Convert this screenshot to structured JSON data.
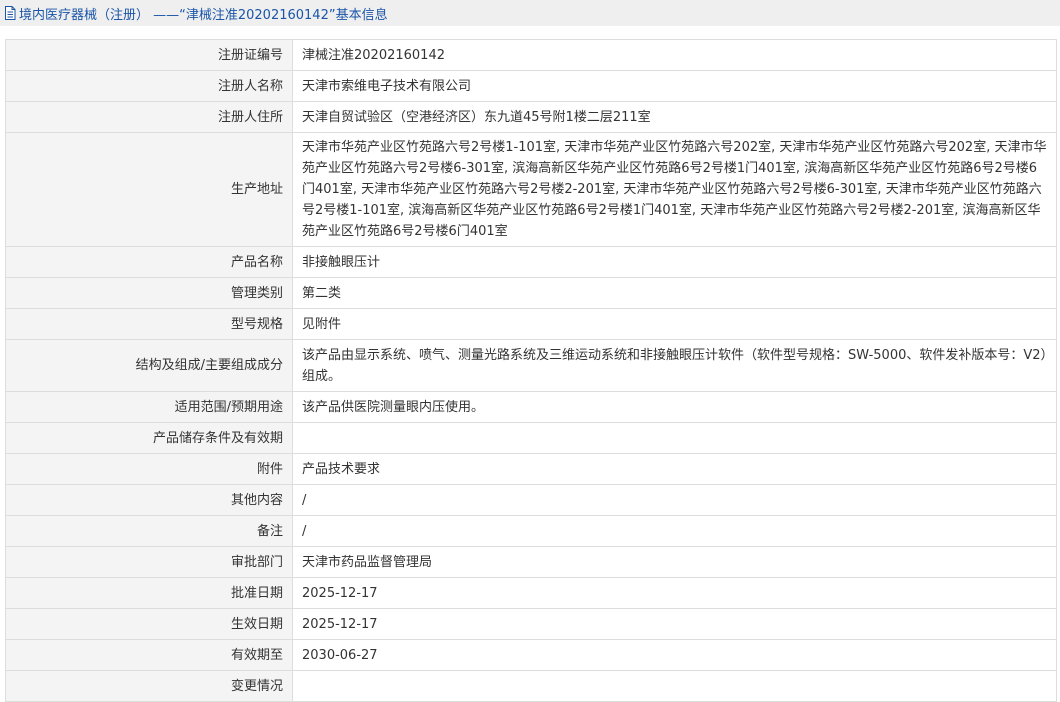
{
  "header": {
    "icon": "document-icon",
    "title": "境内医疗器械（注册） ——“津械注准20202160142”基本信息"
  },
  "rows": [
    {
      "label": "注册证编号",
      "value": "津械注准20202160142"
    },
    {
      "label": "注册人名称",
      "value": "天津市索维电子技术有限公司"
    },
    {
      "label": "注册人住所",
      "value": "天津自贸试验区（空港经济区）东九道45号附1楼二层211室"
    },
    {
      "label": "生产地址",
      "value": "天津市华苑产业区竹苑路六号2号楼1-101室, 天津市华苑产业区竹苑路六号202室, 天津市华苑产业区竹苑路六号202室, 天津市华苑产业区竹苑路六号2号楼6-301室, 滨海高新区华苑产业区竹苑路6号2号楼1门401室, 滨海高新区华苑产业区竹苑路6号2号楼6门401室, 天津市华苑产业区竹苑路六号2号楼2-201室, 天津市华苑产业区竹苑路六号2号楼6-301室, 天津市华苑产业区竹苑路六号2号楼1-101室, 滨海高新区华苑产业区竹苑路6号2号楼1门401室, 天津市华苑产业区竹苑路六号2号楼2-201室, 滨海高新区华苑产业区竹苑路6号2号楼6门401室"
    },
    {
      "label": "产品名称",
      "value": "非接触眼压计"
    },
    {
      "label": "管理类别",
      "value": "第二类"
    },
    {
      "label": "型号规格",
      "value": "见附件"
    },
    {
      "label": "结构及组成/主要组成成分",
      "value": "该产品由显示系统、喷气、测量光路系统及三维运动系统和非接触眼压计软件（软件型号规格：SW-5000、软件发补版本号：V2）组成。"
    },
    {
      "label": "适用范围/预期用途",
      "value": "该产品供医院测量眼内压使用。"
    },
    {
      "label": "产品储存条件及有效期",
      "value": ""
    },
    {
      "label": "附件",
      "value": "产品技术要求"
    },
    {
      "label": "其他内容",
      "value": "/"
    },
    {
      "label": "备注",
      "value": "/"
    },
    {
      "label": "审批部门",
      "value": "天津市药品监督管理局"
    },
    {
      "label": "批准日期",
      "value": "2025-12-17"
    },
    {
      "label": "生效日期",
      "value": "2025-12-17"
    },
    {
      "label": "有效期至",
      "value": "2030-06-27"
    },
    {
      "label": "变更情况",
      "value": ""
    }
  ]
}
